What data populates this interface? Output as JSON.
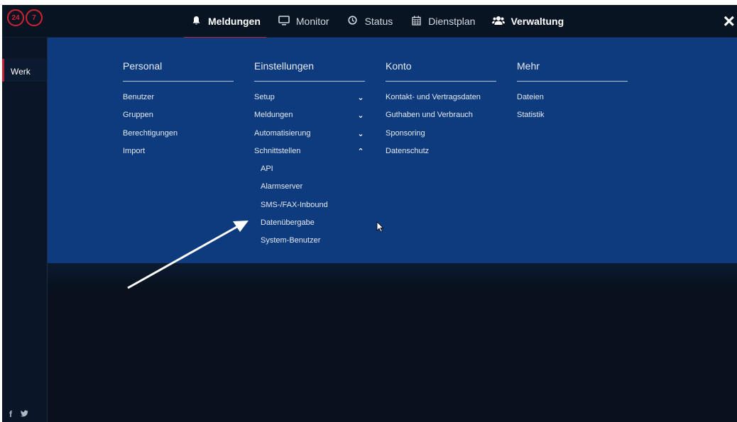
{
  "brand": {
    "logo_left": "24",
    "logo_right": "7"
  },
  "nav": {
    "items": [
      {
        "label": "Meldungen",
        "icon": "bell-icon"
      },
      {
        "label": "Monitor",
        "icon": "monitor-icon"
      },
      {
        "label": "Status",
        "icon": "clock-icon"
      },
      {
        "label": "Dienstplan",
        "icon": "calendar-icon"
      },
      {
        "label": "Verwaltung",
        "icon": "users-icon"
      }
    ],
    "close_icon": "×"
  },
  "sidebar": {
    "item": "Werk",
    "social": [
      "f",
      "🐦"
    ]
  },
  "menu": {
    "personal": {
      "title": "Personal",
      "items": [
        "Benutzer",
        "Gruppen",
        "Berechtigungen",
        "Import"
      ]
    },
    "einstellungen": {
      "title": "Einstellungen",
      "items": [
        "Setup",
        "Meldungen",
        "Automatisierung",
        "Schnittstellen"
      ],
      "subitems": [
        "API",
        "Alarmserver",
        "SMS-/FAX-Inbound",
        "Datenübergabe",
        "System-Benutzer"
      ]
    },
    "konto": {
      "title": "Konto",
      "items": [
        "Kontakt- und Vertragsdaten",
        "Guthaben und Verbrauch",
        "Sponsoring",
        "Datenschutz"
      ]
    },
    "mehr": {
      "title": "Mehr",
      "items": [
        "Dateien",
        "Statistik"
      ]
    }
  },
  "colors": {
    "panel": "#0e3b7d",
    "accent": "#c5202f",
    "background": "#08111d"
  }
}
